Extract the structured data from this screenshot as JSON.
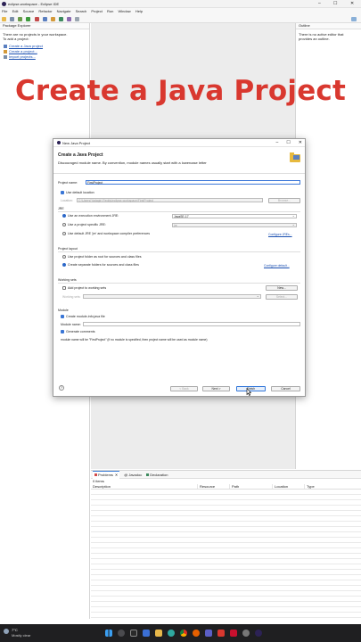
{
  "window": {
    "title": "eclipse-workspace - Eclipse IDE",
    "menu": [
      "File",
      "Edit",
      "Source",
      "Refactor",
      "Navigate",
      "Search",
      "Project",
      "Run",
      "Window",
      "Help"
    ]
  },
  "package_explorer": {
    "title": "Package Explorer",
    "message_line1": "There are no projects in your workspace.",
    "message_line2": "To add a project:",
    "links": [
      "Create a Java project",
      "Create a project...",
      "Import projects..."
    ]
  },
  "outline": {
    "title": "Outline",
    "message_line1": "There is no active editor that",
    "message_line2": "provides an outline."
  },
  "headline": "Create a Java Project",
  "dialog": {
    "title": "New Java Project",
    "header_title": "Create a Java Project",
    "header_message": "Discouraged module name. By convention, module names usually start with a lowercase letter",
    "project_name_label": "Project name:",
    "project_name_value": "FirstProject",
    "use_default_location": "Use default location",
    "location_label": "Location:",
    "location_value": "C:\\Users\\Yadagiri Reddy\\eclipse-workspace\\FirstProject",
    "browse": "Browse...",
    "jre_label": "JRE",
    "jre_option1": "Use an execution environment JRE:",
    "jre_option1_value": "JavaSE-17",
    "jre_option2": "Use a project specific JRE:",
    "jre_option2_value": "jre",
    "jre_option3": "Use default JRE 'jre' and workspace compiler preferences",
    "configure_jres": "Configure JREs...",
    "layout_label": "Project layout",
    "layout_option1": "Use project folder as root for sources and class files",
    "layout_option2": "Create separate folders for sources and class files",
    "configure_default": "Configure default...",
    "working_sets_label": "Working sets",
    "add_to_working_sets": "Add project to working sets",
    "new_button": "New...",
    "working_sets_field": "Working sets:",
    "select_button": "Select...",
    "module_label": "Module",
    "create_module_info": "Create module-info.java file",
    "module_name_label": "Module name:",
    "generate_comments": "Generate comments",
    "module_note": "module name will be \"FirstProject\"  (if no module is specified, then project name will be used as module name)",
    "help": "?",
    "back": "< Back",
    "next": "Next >",
    "finish": "Finish",
    "cancel": "Cancel"
  },
  "problems": {
    "tabs": [
      "Problems",
      "Javadoc",
      "Declaration"
    ],
    "count": "0 items",
    "columns": [
      "Description",
      "Resource",
      "Path",
      "Location",
      "Type"
    ]
  },
  "taskbar": {
    "temperature": "7°C",
    "weather": "Mostly clear"
  },
  "colors": {
    "headline": "#d9382f",
    "accent": "#3a76d6",
    "taskbar": "#1f1f21"
  }
}
